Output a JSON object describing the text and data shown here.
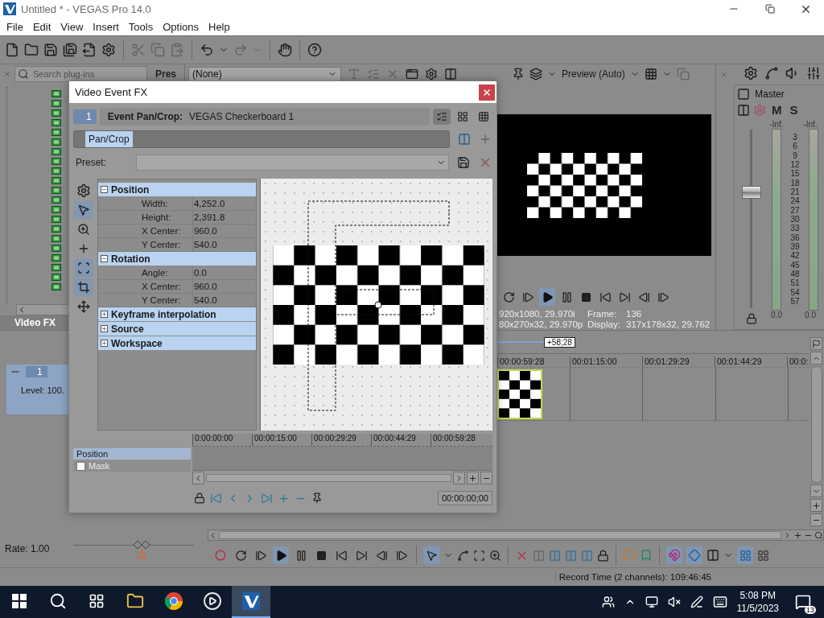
{
  "window": {
    "title": "Untitled * - VEGAS Pro 14.0"
  },
  "menu": [
    "File",
    "Edit",
    "View",
    "Insert",
    "Tools",
    "Options",
    "Help"
  ],
  "toolbar": {
    "clipboard_enabled": false,
    "redo_enabled": false
  },
  "plugins": {
    "search_placeholder": "Search plug-ins",
    "tab": "Pres",
    "title": "Video FX"
  },
  "fx_bar": {
    "preset": "(None)"
  },
  "preview": {
    "mode": "Preview (Auto)",
    "playing": true,
    "info": [
      {
        "format": "920x1080, 29.970i",
        "label": "Frame:",
        "value": "136"
      },
      {
        "format": "80x270x32, 29.970p",
        "label": "Display:",
        "value": "317x178x32, 29.762"
      }
    ]
  },
  "master": {
    "title": "Master",
    "mute": "M",
    "solo": "S",
    "fader": {
      "level": 0.66
    },
    "scale": [
      "3",
      "6",
      "9",
      "12",
      "15",
      "18",
      "21",
      "24",
      "27",
      "30",
      "33",
      "36",
      "39",
      "42",
      "45",
      "48",
      "51",
      "54",
      "57"
    ],
    "meters": [
      {
        "peak": "-Inf.",
        "reading": "0.0"
      },
      {
        "peak": "-Inf.",
        "reading": "0.0"
      }
    ]
  },
  "dialog": {
    "title": "Video Event FX",
    "index": "1",
    "header_label": "Event Pan/Crop:",
    "header_value": "VEGAS Checkerboard 1",
    "chain": [
      {
        "label": "Pan/Crop",
        "selected": true
      }
    ],
    "preset_label": "Preset:",
    "tools": [
      {
        "kind": "settings",
        "selected": false
      },
      {
        "kind": "pointer",
        "selected": true
      },
      {
        "kind": "zoom",
        "selected": false
      },
      {
        "kind": "add",
        "selected": false
      },
      {
        "kind": "snap",
        "selected": true
      },
      {
        "kind": "aspect",
        "selected": true
      },
      {
        "kind": "move",
        "selected": false
      }
    ],
    "sections": [
      {
        "title": "Position",
        "expanded": true,
        "rows": [
          {
            "label": "Width:",
            "value": "4,252.0"
          },
          {
            "label": "Height:",
            "value": "2,391.8"
          },
          {
            "label": "X Center:",
            "value": "960.0"
          },
          {
            "label": "Y Center:",
            "value": "540.0"
          }
        ]
      },
      {
        "title": "Rotation",
        "expanded": true,
        "rows": [
          {
            "label": "Angle:",
            "value": "0.0"
          },
          {
            "label": "X Center:",
            "value": "960.0"
          },
          {
            "label": "Y Center:",
            "value": "540.0"
          }
        ]
      },
      {
        "title": "Keyframe interpolation",
        "expanded": false
      },
      {
        "title": "Source",
        "expanded": false
      },
      {
        "title": "Workspace",
        "expanded": false
      }
    ],
    "keyframe_tracks": [
      {
        "label": "Position",
        "kind": "row",
        "selected": true
      },
      {
        "label": "Mask",
        "kind": "check",
        "checked": false,
        "disabled": true
      }
    ],
    "keyframe_ruler": [
      "0:00:00:00",
      "00:00:15:00",
      "00:00:29:29",
      "00:00:44:29",
      "00:00:59:28"
    ],
    "time": "00:00:00;00"
  },
  "track": {
    "number": "1",
    "level": "Level: 100.",
    "selected": true
  },
  "timeline": {
    "marker": "+58;28",
    "ruler": [
      "00:00:59:28",
      "00:01:15:00",
      "00:01:29:29",
      "00:01:44:29",
      "00:0:"
    ]
  },
  "rate": {
    "label": "Rate: 1.00",
    "level": 0.58
  },
  "edit_bar": {
    "playing": true,
    "snapping": true,
    "auto_crossfade": true
  },
  "status": "Record Time (2 channels): 109:46:45",
  "taskbar": {
    "apps": [
      {
        "kind": "explorer",
        "active": false
      },
      {
        "kind": "browser",
        "active": false
      },
      {
        "kind": "media",
        "active": false
      },
      {
        "kind": "vegas",
        "active": true
      }
    ],
    "time": "5:08 PM",
    "date": "11/5/2023",
    "notifications": "13"
  }
}
